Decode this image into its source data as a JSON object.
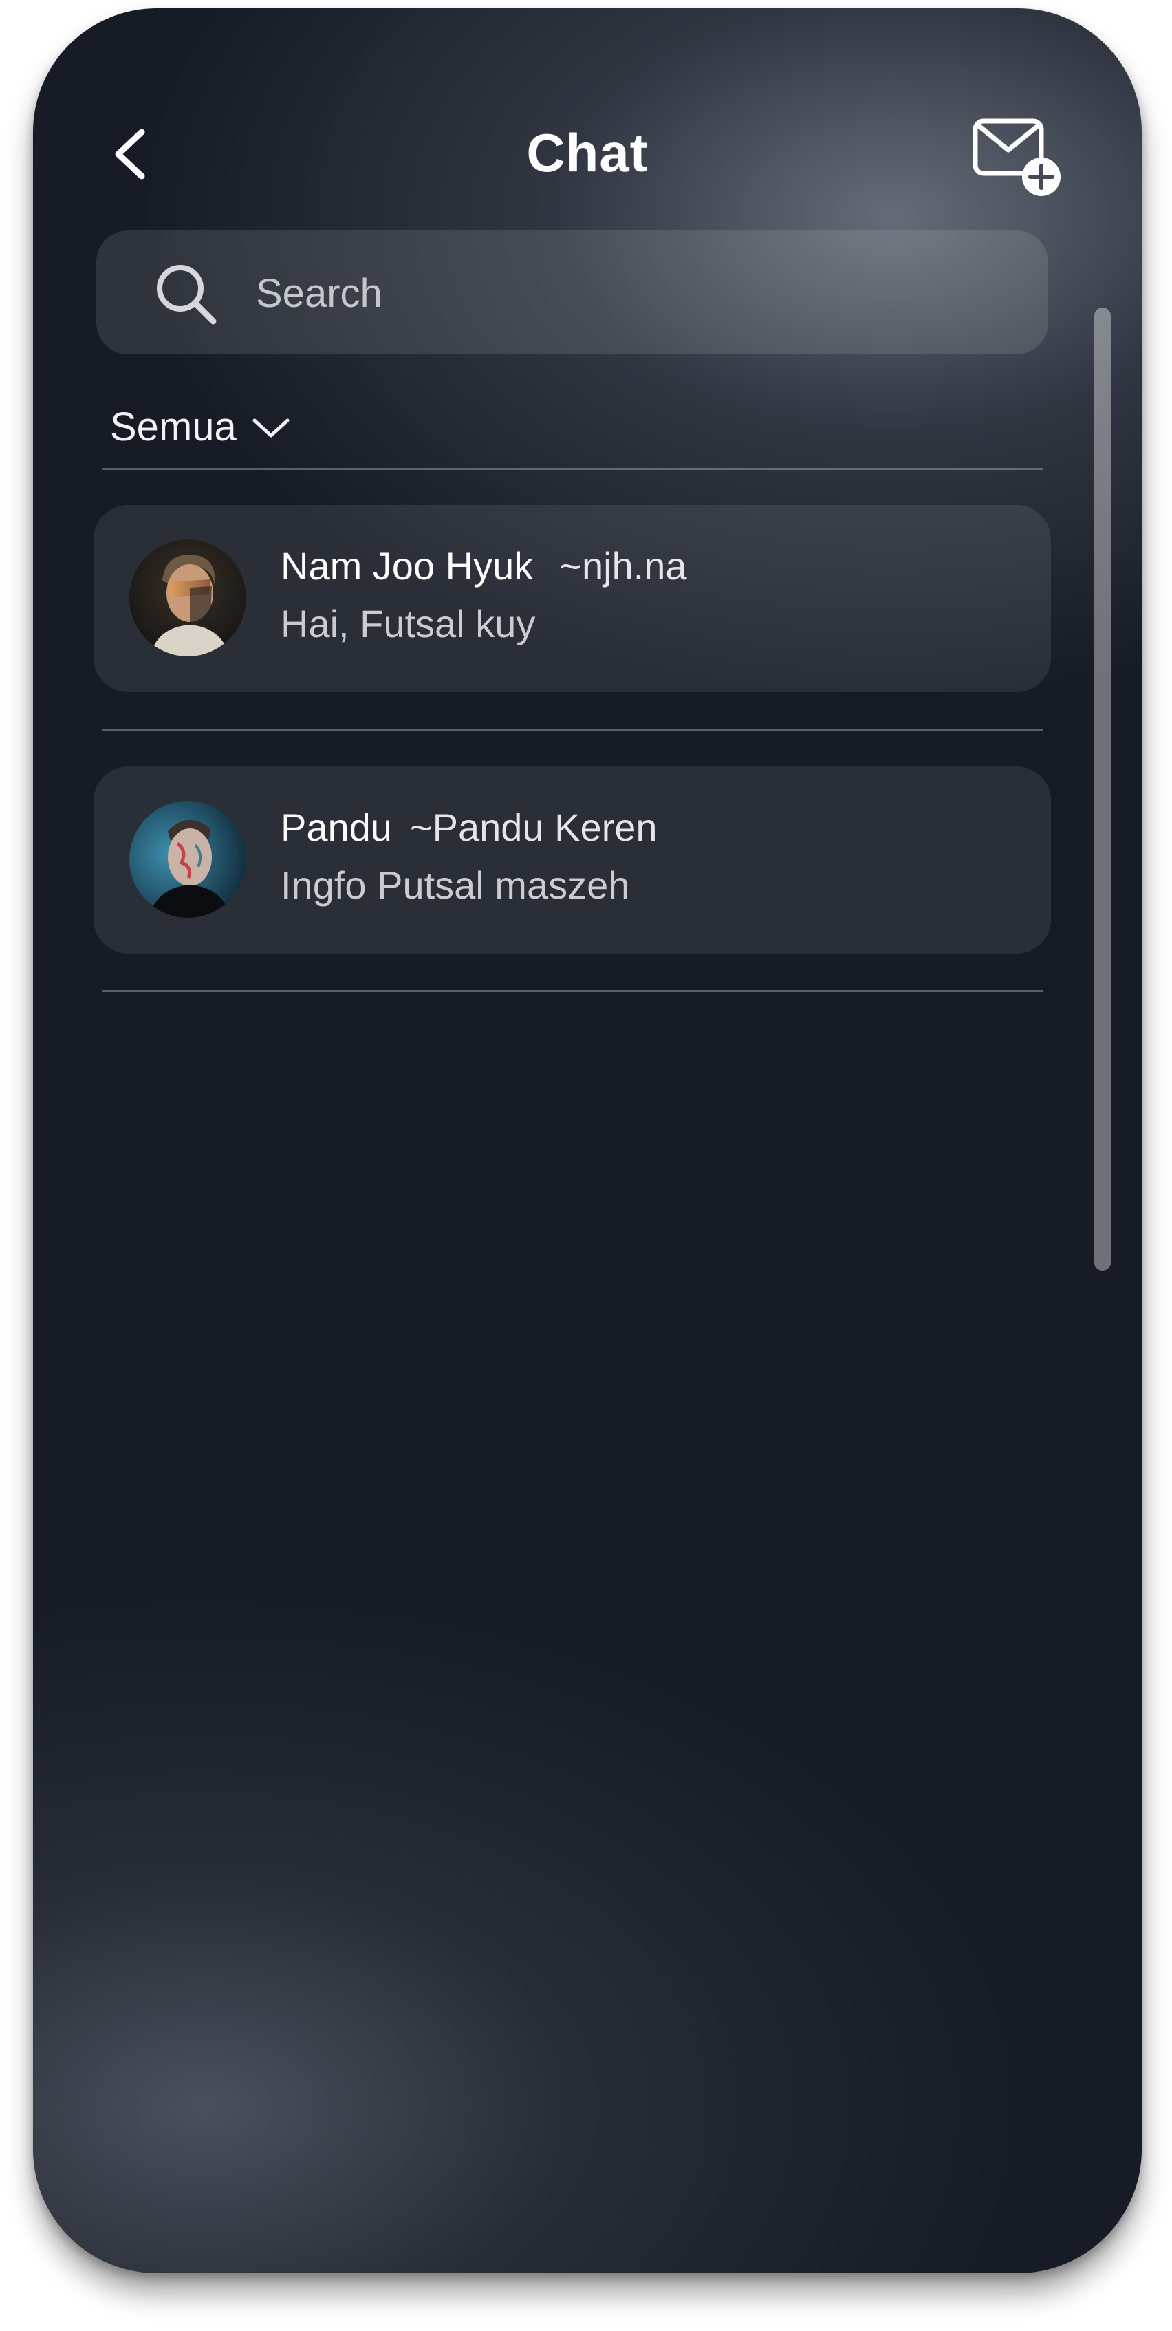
{
  "header": {
    "title": "Chat",
    "back_icon": "chevron-left-icon",
    "compose_icon": "mail-plus-icon"
  },
  "search": {
    "placeholder": "Search",
    "value": "",
    "icon": "search-icon"
  },
  "filter": {
    "label": "Semua",
    "icon": "chevron-down-icon"
  },
  "chats": [
    {
      "name": "Nam Joo Hyuk",
      "alias": "~njh.na",
      "message": "Hai, Futsal kuy"
    },
    {
      "name": "Pandu",
      "alias": "~Pandu Keren",
      "message": "Ingfo Putsal maszeh"
    }
  ],
  "colors": {
    "background": "#161b25",
    "text": "#ffffff",
    "muted_text": "#c9ccd2"
  }
}
